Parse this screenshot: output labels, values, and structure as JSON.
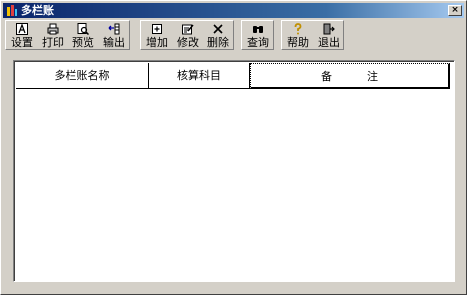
{
  "window": {
    "title": "多栏账",
    "close_glyph": "×"
  },
  "toolbar": {
    "group1": [
      {
        "name": "settings",
        "label": "设置",
        "icon": "font-A-icon"
      },
      {
        "name": "print",
        "label": "打印",
        "icon": "printer-icon"
      },
      {
        "name": "preview",
        "label": "预览",
        "icon": "preview-icon"
      },
      {
        "name": "export",
        "label": "输出",
        "icon": "export-icon"
      }
    ],
    "group2": [
      {
        "name": "add",
        "label": "增加",
        "icon": "add-icon"
      },
      {
        "name": "edit",
        "label": "修改",
        "icon": "edit-icon"
      },
      {
        "name": "delete",
        "label": "删除",
        "icon": "delete-icon"
      }
    ],
    "group3": [
      {
        "name": "query",
        "label": "查询",
        "icon": "binoculars-icon"
      }
    ],
    "group4": [
      {
        "name": "help",
        "label": "帮助",
        "icon": "help-icon"
      },
      {
        "name": "exit",
        "label": "退出",
        "icon": "exit-icon"
      }
    ]
  },
  "grid": {
    "headers": [
      "多栏账名称",
      "核算科目",
      "备          注"
    ]
  }
}
